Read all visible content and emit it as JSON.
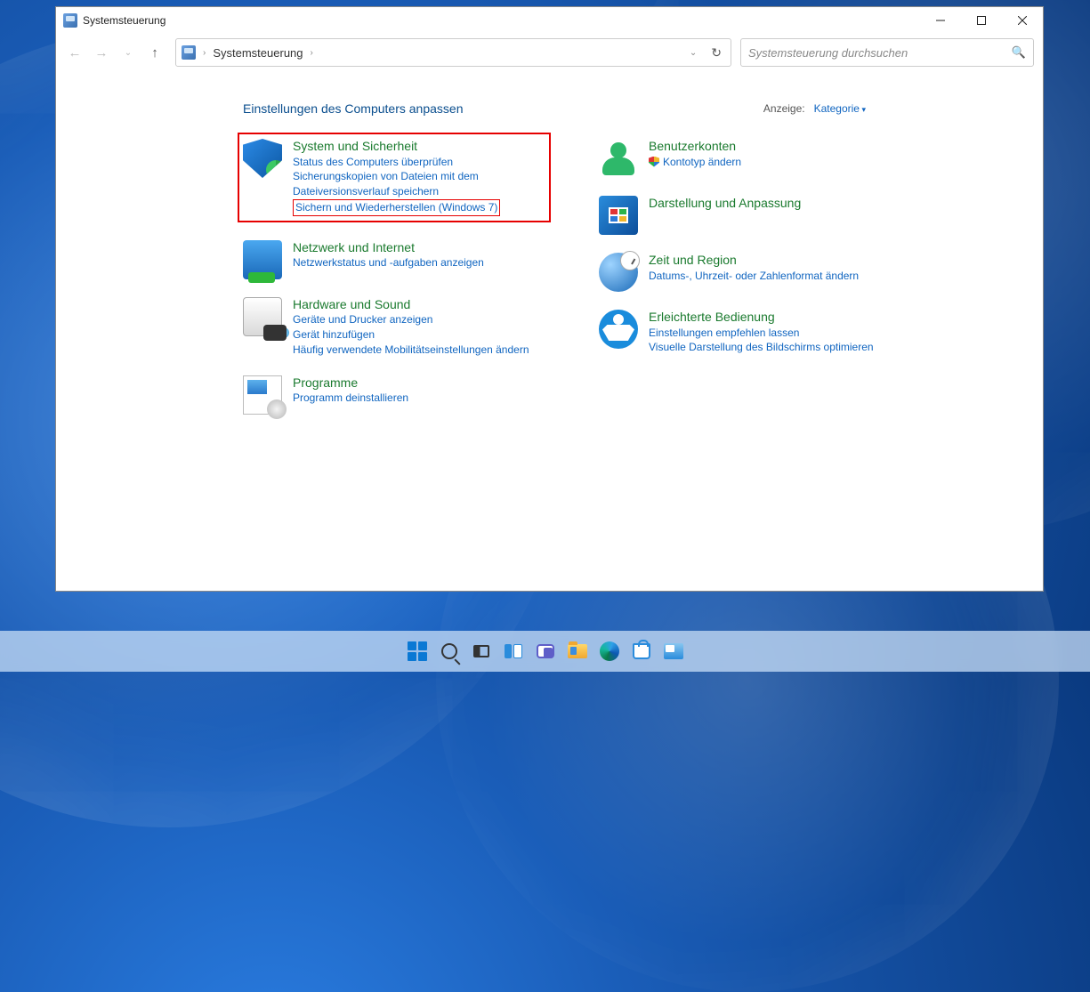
{
  "window": {
    "title": "Systemsteuerung",
    "breadcrumb": {
      "root": "Systemsteuerung"
    },
    "search_placeholder": "Systemsteuerung durchsuchen"
  },
  "content": {
    "heading": "Einstellungen des Computers anpassen",
    "view_label": "Anzeige:",
    "view_value": "Kategorie"
  },
  "categories_left": [
    {
      "title": "System und Sicherheit",
      "links": [
        "Status des Computers überprüfen",
        "Sicherungskopien von Dateien mit dem Dateiversionsverlauf speichern",
        "Sichern und Wiederherstellen (Windows 7)"
      ],
      "highlight": true,
      "box_link_index": 2
    },
    {
      "title": "Netzwerk und Internet",
      "links": [
        "Netzwerkstatus und -aufgaben anzeigen"
      ]
    },
    {
      "title": "Hardware und Sound",
      "links": [
        "Geräte und Drucker anzeigen",
        "Gerät hinzufügen",
        "Häufig verwendete Mobilitätseinstellungen ändern"
      ]
    },
    {
      "title": "Programme",
      "links": [
        "Programm deinstallieren"
      ]
    }
  ],
  "categories_right": [
    {
      "title": "Benutzerkonten",
      "links": [
        "Kontotyp ändern"
      ],
      "shield_link": true
    },
    {
      "title": "Darstellung und Anpassung",
      "links": []
    },
    {
      "title": "Zeit und Region",
      "links": [
        "Datums-, Uhrzeit- oder Zahlenformat ändern"
      ]
    },
    {
      "title": "Erleichterte Bedienung",
      "links": [
        "Einstellungen empfehlen lassen",
        "Visuelle Darstellung des Bildschirms optimieren"
      ]
    }
  ]
}
